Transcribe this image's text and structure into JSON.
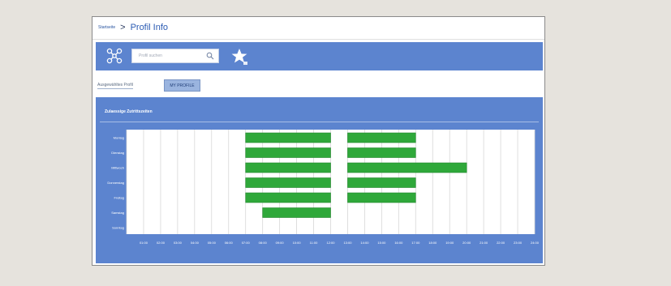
{
  "breadcrumb": {
    "root": "Startseite",
    "separator": ">",
    "current": "Profil Info"
  },
  "toolbar": {
    "app_icon": "network-icon",
    "search": {
      "placeholder": "Profil suchen"
    },
    "search_icon": "search-icon",
    "favorite_icon": "star-icon"
  },
  "profile": {
    "label": "Ausgewähltes Profil",
    "button": "MY PROFILE"
  },
  "panel": {
    "title": "Zulaessige Zutrittszeiten"
  },
  "colors": {
    "bar": "#2fa83a",
    "panel": "#5c84cf",
    "grid": "#d7d7d7"
  },
  "chart_data": {
    "type": "bar",
    "orientation": "horizontal",
    "title": "Zulaessige Zutrittszeiten",
    "categories": [
      "Montag",
      "Dienstag",
      "Mittwoch",
      "Donnerstag",
      "Freitag",
      "Samstag",
      "Sonntag"
    ],
    "x_ticks": [
      "01:00",
      "02:00",
      "03:00",
      "04:00",
      "05:00",
      "06:00",
      "07:00",
      "08:00",
      "09:00",
      "10:00",
      "11:00",
      "12:00",
      "13:00",
      "14:00",
      "15:00",
      "16:00",
      "17:00",
      "18:00",
      "19:00",
      "20:00",
      "21:00",
      "22:00",
      "23:00",
      "24:00"
    ],
    "xlim": [
      0,
      24
    ],
    "grid": true,
    "intervals": [
      {
        "day": "Montag",
        "start": 7,
        "end": 12
      },
      {
        "day": "Montag",
        "start": 13,
        "end": 17
      },
      {
        "day": "Dienstag",
        "start": 7,
        "end": 12
      },
      {
        "day": "Dienstag",
        "start": 13,
        "end": 17
      },
      {
        "day": "Mittwoch",
        "start": 7,
        "end": 12
      },
      {
        "day": "Mittwoch",
        "start": 13,
        "end": 20
      },
      {
        "day": "Donnerstag",
        "start": 7,
        "end": 12
      },
      {
        "day": "Donnerstag",
        "start": 13,
        "end": 17
      },
      {
        "day": "Freitag",
        "start": 7,
        "end": 12
      },
      {
        "day": "Freitag",
        "start": 13,
        "end": 17
      },
      {
        "day": "Samstag",
        "start": 8,
        "end": 12
      }
    ]
  }
}
